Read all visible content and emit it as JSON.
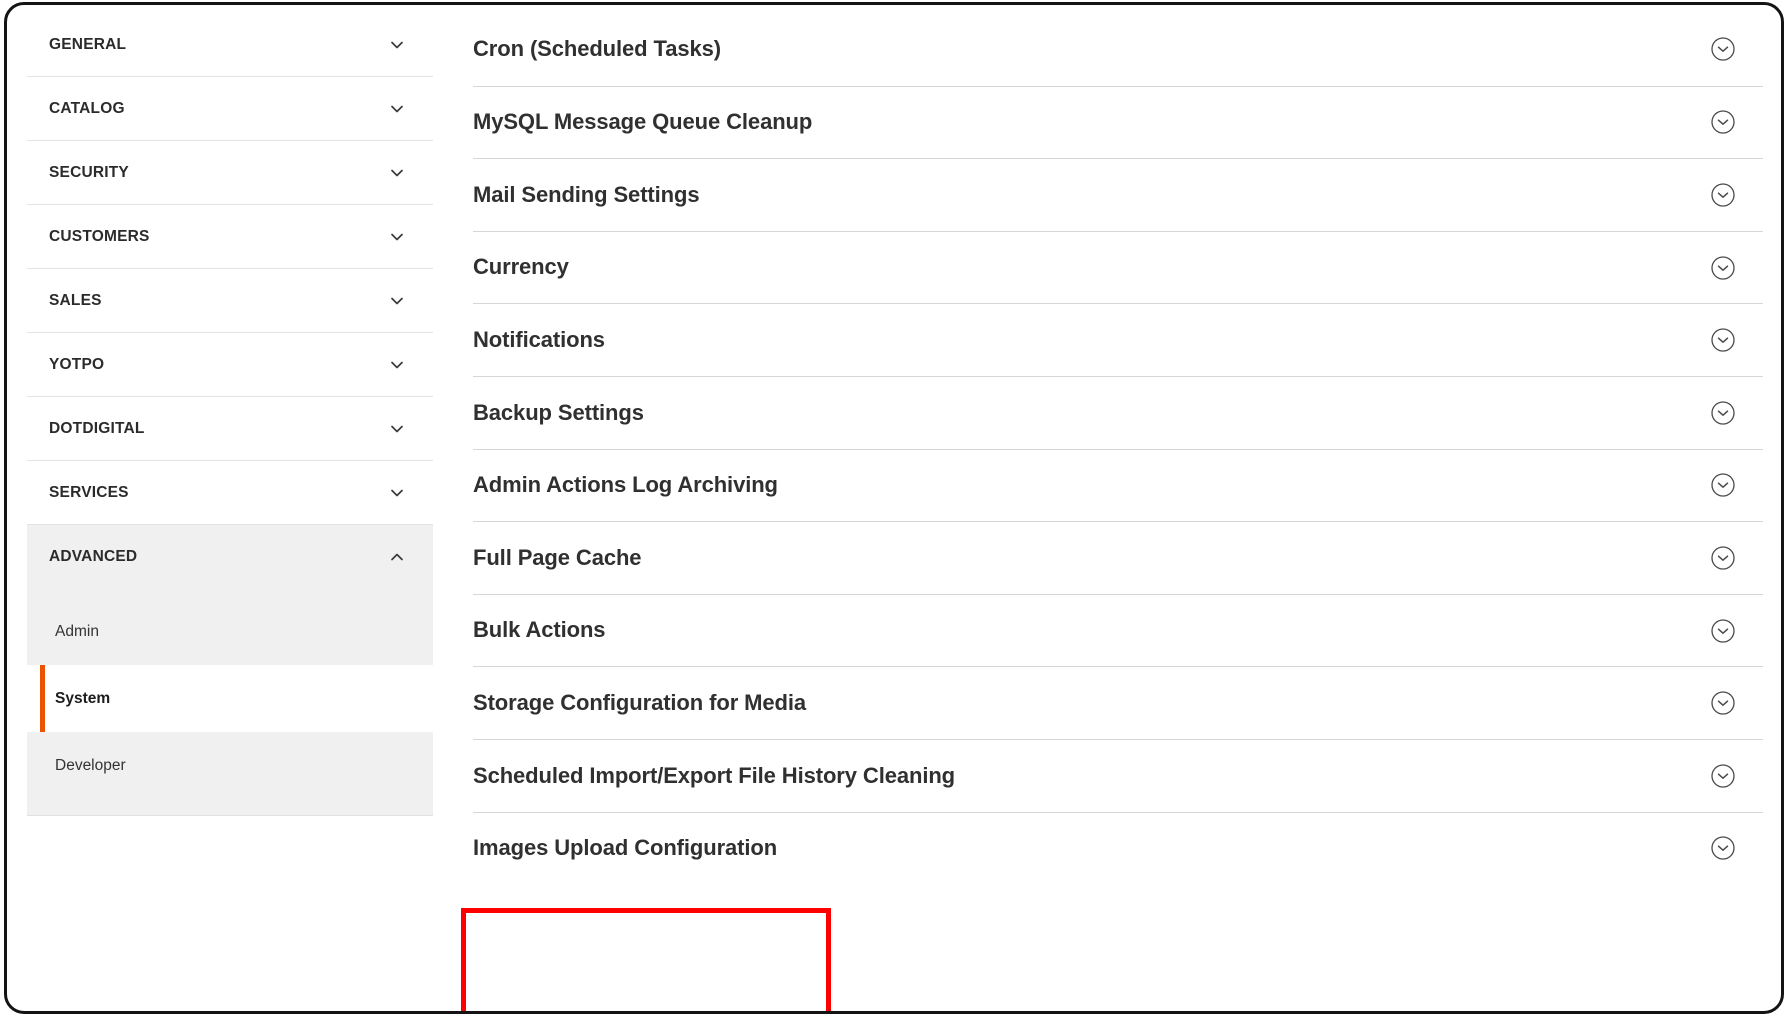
{
  "accent_colors": {
    "active_marker": "#eb5202",
    "highlight_box": "#ff0000",
    "section_open_bg": "#f0f0f0",
    "divider": "#d6d6d6"
  },
  "sidebar": {
    "sections": [
      {
        "label": "GENERAL",
        "icon": "chevron-down-icon",
        "expanded": false
      },
      {
        "label": "CATALOG",
        "icon": "chevron-down-icon",
        "expanded": false
      },
      {
        "label": "SECURITY",
        "icon": "chevron-down-icon",
        "expanded": false
      },
      {
        "label": "CUSTOMERS",
        "icon": "chevron-down-icon",
        "expanded": false
      },
      {
        "label": "SALES",
        "icon": "chevron-down-icon",
        "expanded": false
      },
      {
        "label": "YOTPO",
        "icon": "chevron-down-icon",
        "expanded": false
      },
      {
        "label": "DOTDIGITAL",
        "icon": "chevron-down-icon",
        "expanded": false
      },
      {
        "label": "SERVICES",
        "icon": "chevron-down-icon",
        "expanded": false
      },
      {
        "label": "ADVANCED",
        "icon": "chevron-up-icon",
        "expanded": true
      }
    ],
    "advanced_submenu": [
      {
        "label": "Admin",
        "active": false
      },
      {
        "label": "System",
        "active": true
      },
      {
        "label": "Developer",
        "active": false
      }
    ]
  },
  "main": {
    "groups": [
      {
        "title": "Cron (Scheduled Tasks)",
        "toggle_icon": "chevron-down-circle-icon"
      },
      {
        "title": "MySQL Message Queue Cleanup",
        "toggle_icon": "chevron-down-circle-icon"
      },
      {
        "title": "Mail Sending Settings",
        "toggle_icon": "chevron-down-circle-icon"
      },
      {
        "title": "Currency",
        "toggle_icon": "chevron-down-circle-icon"
      },
      {
        "title": "Notifications",
        "toggle_icon": "chevron-down-circle-icon"
      },
      {
        "title": "Backup Settings",
        "toggle_icon": "chevron-down-circle-icon"
      },
      {
        "title": "Admin Actions Log Archiving",
        "toggle_icon": "chevron-down-circle-icon"
      },
      {
        "title": "Full Page Cache",
        "toggle_icon": "chevron-down-circle-icon"
      },
      {
        "title": "Bulk Actions",
        "toggle_icon": "chevron-down-circle-icon"
      },
      {
        "title": "Storage Configuration for Media",
        "toggle_icon": "chevron-down-circle-icon"
      },
      {
        "title": "Scheduled Import/Export File History Cleaning",
        "toggle_icon": "chevron-down-circle-icon"
      },
      {
        "title": "Images Upload Configuration",
        "toggle_icon": "chevron-down-circle-icon",
        "highlighted": true
      }
    ]
  }
}
